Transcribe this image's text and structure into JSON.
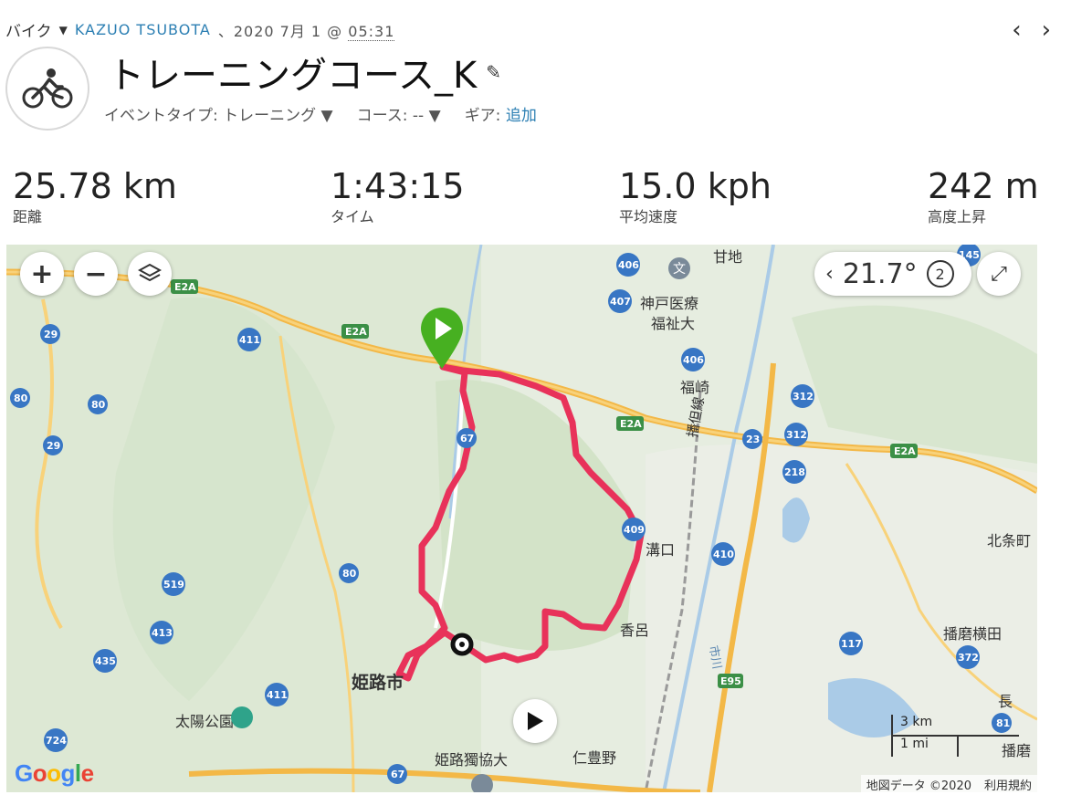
{
  "activity": {
    "type": "バイク",
    "user": "KAZUO TSUBOTA",
    "date": "、2020 7月 1 @",
    "time": "05:31",
    "title": "トレーニングコース_K",
    "meta": {
      "event_type_label": "イベントタイプ:",
      "event_type_value": "トレーニング",
      "course_label": "コース:",
      "course_value": "--",
      "gear_label": "ギア:",
      "gear_value": "追加"
    }
  },
  "icons": {
    "prev": "chevron-left-icon",
    "next": "chevron-right-icon",
    "activity": "bicycle-icon",
    "edit": "pencil-icon"
  },
  "stats": [
    {
      "value": "25.78 km",
      "label": "距離"
    },
    {
      "value": "1:43:15",
      "label": "タイム"
    },
    {
      "value": "15.0 kph",
      "label": "平均速度"
    },
    {
      "value": "242 m",
      "label": "高度上昇"
    }
  ],
  "map": {
    "rotation": "21.7°",
    "rotation_badge": "2",
    "scale_km": "3 km",
    "scale_mi": "1 mi",
    "attribution": "地図データ ©2020",
    "terms": "利用規約",
    "logo": "Google",
    "places": {
      "kanjichi": "甘地",
      "kobe_iryo": "神戸医療",
      "fukushi": "福祉大",
      "fukusaki": "福崎",
      "bantan_line": "播但線",
      "mizoguchi": "溝口",
      "hojo": "北条町",
      "koro": "香呂",
      "harima_yokota": "播磨横田",
      "himeji_shi": "姫路市",
      "taiyo": "太陽公園",
      "dokkyo": "姫路獨協大",
      "nibuno": "仁豊野",
      "naga": "長",
      "harima": "播磨",
      "ichikawa": "市川"
    },
    "shields": [
      "E2A",
      "E2A",
      "E2A",
      "E2A",
      "29",
      "29",
      "80",
      "80",
      "80",
      "411",
      "411",
      "519",
      "413",
      "435",
      "724",
      "67",
      "406",
      "406",
      "407",
      "312",
      "312",
      "23",
      "218",
      "409",
      "410",
      "117",
      "372",
      "E95",
      "145",
      "81",
      "67"
    ]
  },
  "colors": {
    "route": "#e8325a",
    "start": "#47b021",
    "link": "#2c7fb3"
  }
}
